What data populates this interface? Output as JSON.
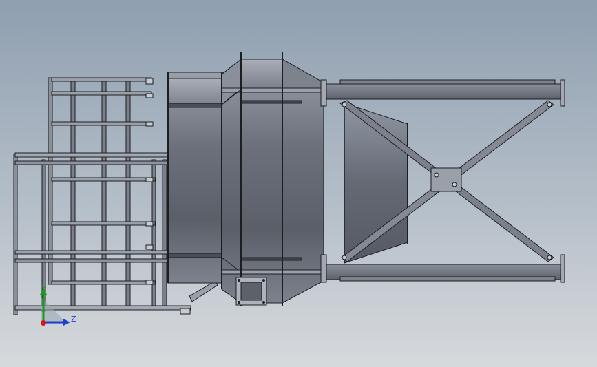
{
  "triad": {
    "y_label": "Y",
    "z_label": "Z",
    "colors": {
      "y": "#1a9a1a",
      "z": "#1f3fd0",
      "x": "#d01a1a"
    }
  },
  "colors": {
    "background_top": "#8f9fb0",
    "background_bottom": "#d6d9dc",
    "steel": "#6e737c",
    "steel_dark": "#3c4047",
    "edge": "#1c1e22"
  }
}
